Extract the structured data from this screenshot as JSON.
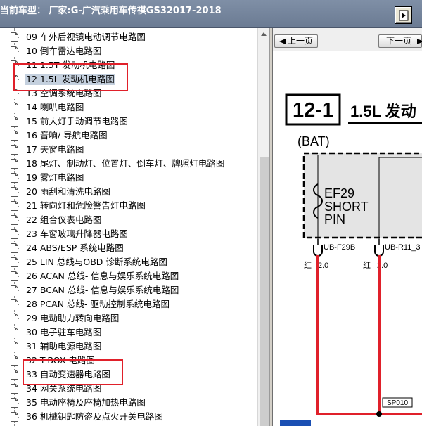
{
  "header": {
    "title": "当前车型：  厂家:G-广汽乘用车传祺GS32017-2018"
  },
  "tree": {
    "items": [
      {
        "label": "09 车外后视镜电动调节电路图",
        "selected": false
      },
      {
        "label": "10 倒车雷达电路图",
        "selected": false
      },
      {
        "label": "11 1.5T 发动机电路图",
        "selected": false
      },
      {
        "label": "12 1.5L 发动机电路图",
        "selected": true
      },
      {
        "label": "13 空调系统电路图",
        "selected": false
      },
      {
        "label": "14 喇叭电路图",
        "selected": false
      },
      {
        "label": "15 前大灯手动调节电路图",
        "selected": false
      },
      {
        "label": "16 音响/ 导航电路图",
        "selected": false
      },
      {
        "label": "17 天窗电路图",
        "selected": false
      },
      {
        "label": "18 尾灯、制动灯、位置灯、倒车灯、牌照灯电路图",
        "selected": false
      },
      {
        "label": "19 雾灯电路图",
        "selected": false
      },
      {
        "label": "20 雨刮和清洗电路图",
        "selected": false
      },
      {
        "label": "21 转向灯和危险警告灯电路图",
        "selected": false
      },
      {
        "label": "22 组合仪表电路图",
        "selected": false
      },
      {
        "label": "23 车窗玻璃升降器电路图",
        "selected": false
      },
      {
        "label": "24 ABS/ESP 系统电路图",
        "selected": false
      },
      {
        "label": "25 LIN 总线与OBD 诊断系统电路图",
        "selected": false
      },
      {
        "label": "26 ACAN 总线- 信息与娱乐系统电路图",
        "selected": false
      },
      {
        "label": "27 BCAN 总线- 信息与娱乐系统电路图",
        "selected": false
      },
      {
        "label": "28 PCAN 总线- 驱动控制系统电路图",
        "selected": false
      },
      {
        "label": "29 电动助力转向电路图",
        "selected": false
      },
      {
        "label": "30 电子驻车电路图",
        "selected": false
      },
      {
        "label": "31 辅助电源电路图",
        "selected": false
      },
      {
        "label": "32 T-BOX 电路图",
        "selected": false
      },
      {
        "label": "33 自动变速器电路图",
        "selected": false
      },
      {
        "label": "34 网关系统电路图",
        "selected": false
      },
      {
        "label": "35 电动座椅及座椅加热电路图",
        "selected": false
      },
      {
        "label": "36 机械钥匙防盗及点火开关电路图",
        "selected": false
      }
    ]
  },
  "viewer": {
    "prev_label": "上一页",
    "next_label": "下一页",
    "section_number": "12-1",
    "section_title": "1.5L 发动",
    "bat_label": "(BAT)",
    "fuse_name": "EF29",
    "fuse_type_line1": "SHORT",
    "fuse_type_line2": "PIN",
    "connector_1": "UB-F29B",
    "connector_2": "UB-R11_3",
    "wire_1_color": "红",
    "wire_1_gauge": "2.0",
    "wire_2_color": "红",
    "wire_2_gauge": "2.0",
    "splice_label": "SP010"
  },
  "colors": {
    "header_bg": "#7586a0",
    "wire_red": "#e0202a",
    "highlight_box": "#e0202a",
    "selected_bg": "#c4d0de",
    "fuse_box_fill": "#e4e4e4"
  }
}
